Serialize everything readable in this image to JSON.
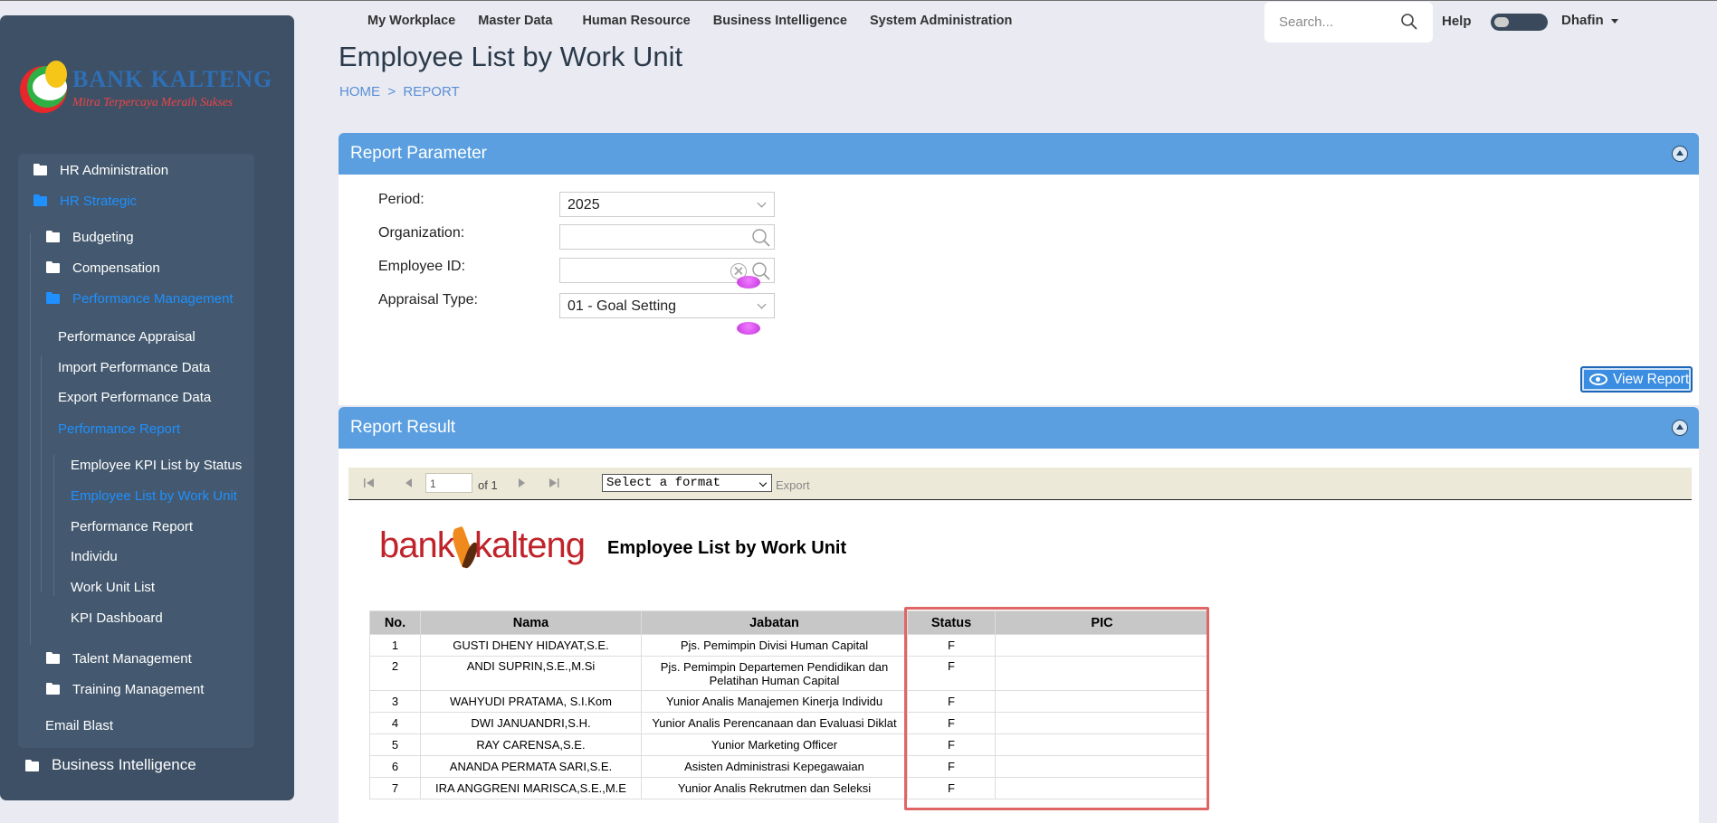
{
  "sidebar": {
    "logo_name": "BANK KALTENG",
    "logo_tagline": "Mitra Terpercaya Meraih Sukses",
    "items": [
      {
        "label": "HR Administration"
      },
      {
        "label": "HR Strategic"
      },
      {
        "label": "Budgeting"
      },
      {
        "label": "Compensation"
      },
      {
        "label": "Performance Management"
      },
      {
        "label": "Performance Appraisal"
      },
      {
        "label": "Import Performance Data"
      },
      {
        "label": "Export Performance Data"
      },
      {
        "label": "Performance Report"
      },
      {
        "label": "Employee KPI List by Status"
      },
      {
        "label": "Employee List by Work Unit"
      },
      {
        "label": "Performance Report"
      },
      {
        "label": "Individu"
      },
      {
        "label": "Work Unit List"
      },
      {
        "label": "KPI Dashboard"
      },
      {
        "label": "Talent Management"
      },
      {
        "label": "Training Management"
      },
      {
        "label": "Email Blast"
      },
      {
        "label": "Business Intelligence"
      }
    ]
  },
  "topnav": {
    "items": [
      "My Workplace",
      "Master Data",
      "Human Resource",
      "Business Intelligence",
      "System Administration"
    ],
    "search_placeholder": "Search...",
    "help": "Help",
    "user": "Dhafin"
  },
  "page": {
    "title": "Employee List by Work Unit",
    "breadcrumb": "HOME  >  REPORT"
  },
  "params": {
    "header": "Report Parameter",
    "period_label": "Period:",
    "period_value": "2025",
    "org_label": "Organization:",
    "org_value": "",
    "emp_label": "Employee ID:",
    "emp_value": "",
    "appraisal_label": "Appraisal Type:",
    "appraisal_value": "01 - Goal Setting",
    "view_button": "View Report"
  },
  "result": {
    "header": "Report Result",
    "page_current": "1",
    "page_of": "of 1",
    "format_select": "Select a format",
    "export": "Export",
    "bank_logo_1": "bank",
    "bank_logo_2": "kalteng",
    "report_title": "Employee List by Work Unit",
    "columns": [
      "No.",
      "Nama",
      "Jabatan",
      "Status",
      "PIC"
    ],
    "rows": [
      {
        "no": "1",
        "nama": "GUSTI DHENY HIDAYAT,S.E.",
        "jabatan": "Pjs. Pemimpin Divisi Human Capital",
        "status": "F",
        "pic": ""
      },
      {
        "no": "2",
        "nama": "ANDI SUPRIN,S.E.,M.Si",
        "jabatan": "Pjs. Pemimpin Departemen  Pendidikan dan Pelatihan Human Capital",
        "status": "F",
        "pic": ""
      },
      {
        "no": "3",
        "nama": "WAHYUDI PRATAMA, S.I.Kom",
        "jabatan": "Yunior Analis Manajemen Kinerja Individu",
        "status": "F",
        "pic": ""
      },
      {
        "no": "4",
        "nama": "DWI JANUANDRI,S.H.",
        "jabatan": "Yunior Analis Perencanaan dan  Evaluasi Diklat",
        "status": "F",
        "pic": ""
      },
      {
        "no": "5",
        "nama": "RAY CARENSA,S.E.",
        "jabatan": "Yunior Marketing Officer",
        "status": "F",
        "pic": ""
      },
      {
        "no": "6",
        "nama": "ANANDA PERMATA SARI,S.E.",
        "jabatan": "Asisten Administrasi Kepegawaian",
        "status": "F",
        "pic": ""
      },
      {
        "no": "7",
        "nama": "IRA ANGGRENI MARISCA,S.E.,M.E",
        "jabatan": "Yunior Analis Rekrutmen dan Seleksi",
        "status": "F",
        "pic": ""
      }
    ]
  }
}
